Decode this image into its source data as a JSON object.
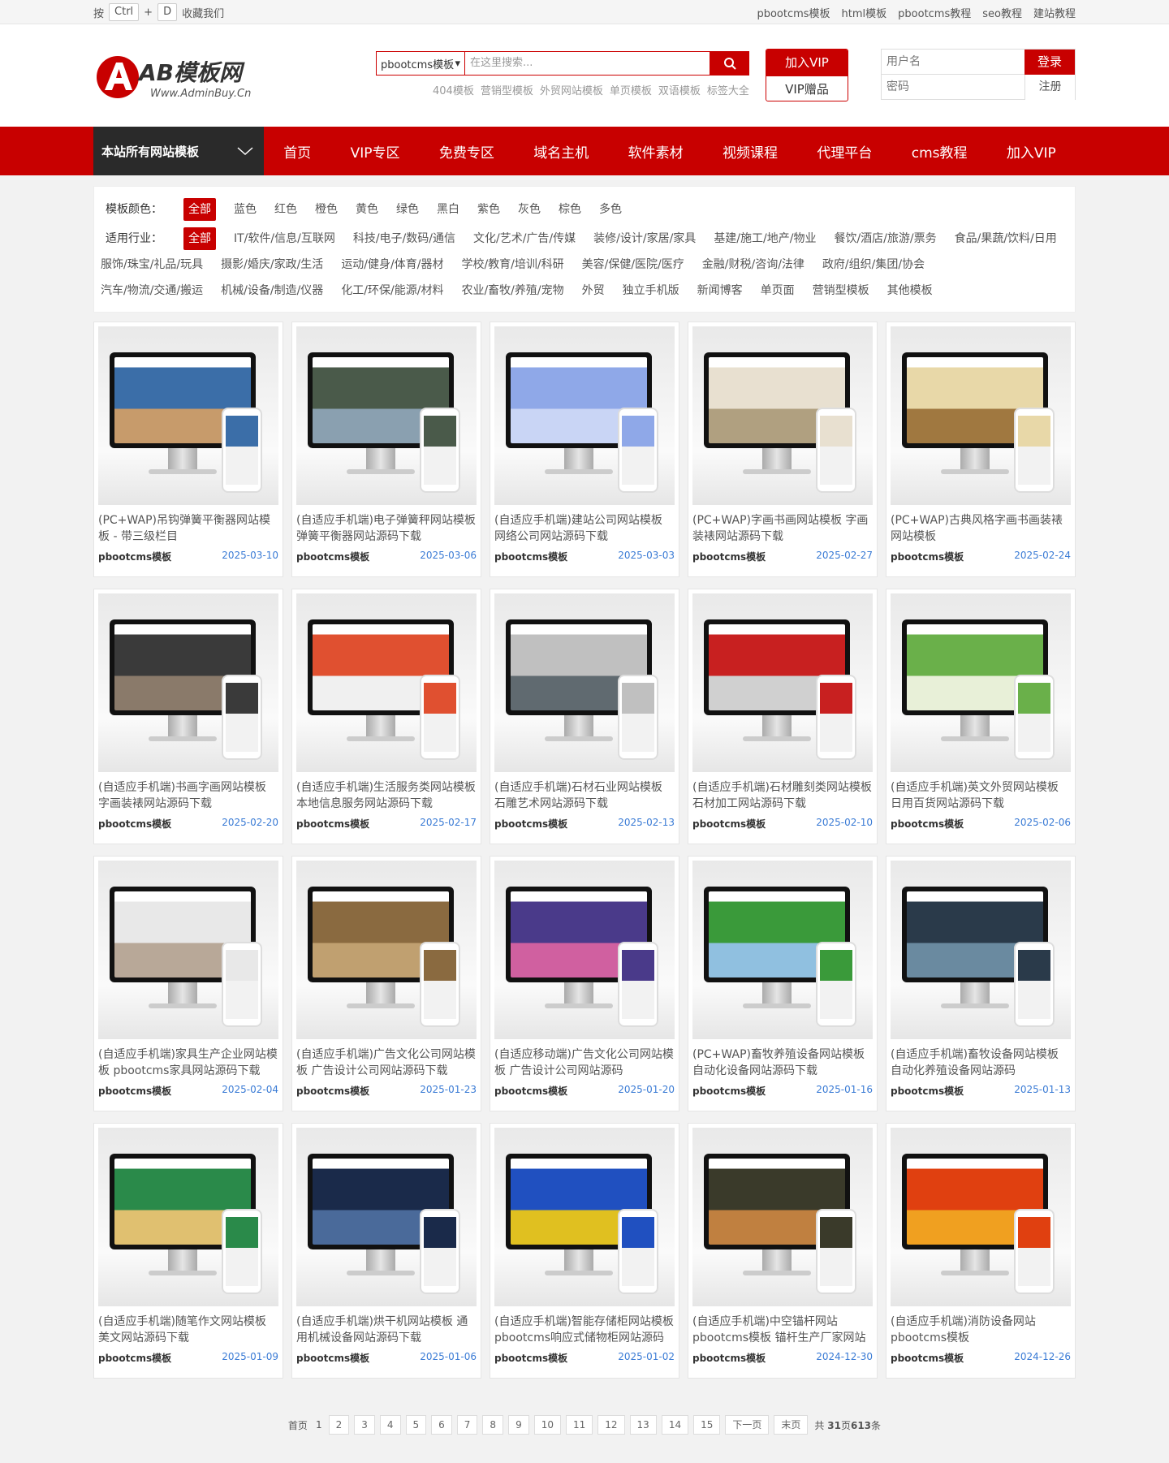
{
  "topbar": {
    "press": "按",
    "key1": "Ctrl",
    "plus": "+",
    "key2": "D",
    "bookmark": "收藏我们",
    "links": [
      "pbootcms模板",
      "html模板",
      "pbootcms教程",
      "seo教程",
      "建站教程"
    ]
  },
  "logo": {
    "text": "AB模板网",
    "sub": "Www.AdminBuy.Cn"
  },
  "search": {
    "select": "pbootcms模板",
    "placeholder": "在这里搜索...",
    "hotwords": [
      "404模板",
      "营销型模板",
      "外贸网站模板",
      "单页模板",
      "双语模板",
      "标签大全"
    ]
  },
  "vip": {
    "join": "加入VIP",
    "gift": "VIP赠品"
  },
  "login": {
    "user": "用户名",
    "pass": "密码",
    "login": "登录",
    "register": "注册"
  },
  "nav": {
    "all": "本站所有网站模板",
    "items": [
      "首页",
      "VIP专区",
      "免费专区",
      "域名主机",
      "软件素材",
      "视频课程",
      "代理平台",
      "cms教程",
      "加入VIP"
    ]
  },
  "filter": {
    "color_label": "模板颜色：",
    "colors": [
      "全部",
      "蓝色",
      "红色",
      "橙色",
      "黄色",
      "绿色",
      "黑白",
      "紫色",
      "灰色",
      "棕色",
      "多色"
    ],
    "industry_label": "适用行业：",
    "industries_row1": [
      "全部",
      "IT/软件/信息/互联网",
      "科技/电子/数码/通信",
      "文化/艺术/广告/传媒",
      "装修/设计/家居/家具",
      "基建/施工/地产/物业",
      "餐饮/酒店/旅游/票务",
      "食品/果蔬/饮料/日用"
    ],
    "industries_row2": [
      "服饰/珠宝/礼品/玩具",
      "摄影/婚庆/家政/生活",
      "运动/健身/体育/器材",
      "学校/教育/培训/科研",
      "美容/保健/医院/医疗",
      "金融/财税/咨询/法律",
      "政府/组织/集团/协会"
    ],
    "industries_row3": [
      "汽车/物流/交通/搬运",
      "机械/设备/制造/仪器",
      "化工/环保/能源/材料",
      "农业/畜牧/养殖/宠物",
      "外贸",
      "独立手机版",
      "新闻博客",
      "单页面",
      "营销型模板",
      "其他模板"
    ]
  },
  "cards": [
    {
      "title": "(PC+WAP)吊钩弹簧平衡器网站模板 - 带三级栏目",
      "cat": "pbootcms模板",
      "date": "2025-03-10",
      "c1": "#3b6ea8",
      "c2": "#c79b6b"
    },
    {
      "title": "(自适应手机端)电子弹簧秤网站模板 弹簧平衡器网站源码下载",
      "cat": "pbootcms模板",
      "date": "2025-03-06",
      "c1": "#4a5a4a",
      "c2": "#8aa0b0"
    },
    {
      "title": "(自适应手机端)建站公司网站模板 网络公司网站源码下载",
      "cat": "pbootcms模板",
      "date": "2025-03-03",
      "c1": "#8fa8e8",
      "c2": "#c9d5f5"
    },
    {
      "title": "(PC+WAP)字画书画网站模板 字画装裱网站源码下载",
      "cat": "pbootcms模板",
      "date": "2025-02-27",
      "c1": "#e8e0d0",
      "c2": "#b0a080"
    },
    {
      "title": "(PC+WAP)古典风格字画书画装裱网站模板",
      "cat": "pbootcms模板",
      "date": "2025-02-24",
      "c1": "#e8d8a8",
      "c2": "#a07840"
    },
    {
      "title": "(自适应手机端)书画字画网站模板 字画装裱网站源码下载",
      "cat": "pbootcms模板",
      "date": "2025-02-20",
      "c1": "#3a3a3a",
      "c2": "#8a7a6a"
    },
    {
      "title": "(自适应手机端)生活服务类网站模板 本地信息服务网站源码下载",
      "cat": "pbootcms模板",
      "date": "2025-02-17",
      "c1": "#e05030",
      "c2": "#f0f0f0"
    },
    {
      "title": "(自适应手机端)石材石业网站模板 石雕艺术网站源码下载",
      "cat": "pbootcms模板",
      "date": "2025-02-13",
      "c1": "#c0c0c0",
      "c2": "#606a70"
    },
    {
      "title": "(自适应手机端)石材雕刻类网站模板 石材加工网站源码下载",
      "cat": "pbootcms模板",
      "date": "2025-02-10",
      "c1": "#c82020",
      "c2": "#d0d0d0"
    },
    {
      "title": "(自适应手机端)英文外贸网站模板 日用百货网站源码下载",
      "cat": "pbootcms模板",
      "date": "2025-02-06",
      "c1": "#6ab04a",
      "c2": "#e8f0d8"
    },
    {
      "title": "(自适应手机端)家具生产企业网站模板 pbootcms家具网站源码下载",
      "cat": "pbootcms模板",
      "date": "2025-02-04",
      "c1": "#e8e8e8",
      "c2": "#b8a898"
    },
    {
      "title": "(自适应手机端)广告文化公司网站模板 广告设计公司网站源码下载",
      "cat": "pbootcms模板",
      "date": "2025-01-23",
      "c1": "#8a6a40",
      "c2": "#c0a070"
    },
    {
      "title": "(自适应移动端)广告文化公司网站模板 广告设计公司网站源码",
      "cat": "pbootcms模板",
      "date": "2025-01-20",
      "c1": "#4a3a8a",
      "c2": "#d060a0"
    },
    {
      "title": "(PC+WAP)畜牧养殖设备网站模板 自动化设备网站源码下载",
      "cat": "pbootcms模板",
      "date": "2025-01-16",
      "c1": "#3a9a3a",
      "c2": "#90c0e0"
    },
    {
      "title": "(自适应手机端)畜牧设备网站模板 自动化养殖设备网站源码",
      "cat": "pbootcms模板",
      "date": "2025-01-13",
      "c1": "#2a3a4a",
      "c2": "#6a8aa0"
    },
    {
      "title": "(自适应手机端)随笔作文网站模板 美文网站源码下载",
      "cat": "pbootcms模板",
      "date": "2025-01-09",
      "c1": "#2a8a4a",
      "c2": "#e0c070"
    },
    {
      "title": "(自适应手机端)烘干机网站模板 通用机械设备网站源码下载",
      "cat": "pbootcms模板",
      "date": "2025-01-06",
      "c1": "#1a2a4a",
      "c2": "#4a6a9a"
    },
    {
      "title": "(自适应手机端)智能存储柜网站模板 pbootcms响应式储物柜网站源码",
      "cat": "pbootcms模板",
      "date": "2025-01-02",
      "c1": "#2050c0",
      "c2": "#e0c020"
    },
    {
      "title": "(自适应手机端)中空锚杆网站 pbootcms模板 锚杆生产厂家网站",
      "cat": "pbootcms模板",
      "date": "2024-12-30",
      "c1": "#3a3a2a",
      "c2": "#c08040"
    },
    {
      "title": "(自适应手机端)消防设备网站 pbootcms模板",
      "cat": "pbootcms模板",
      "date": "2024-12-26",
      "c1": "#e04010",
      "c2": "#f0a020"
    }
  ],
  "pager": {
    "first": "首页",
    "current": "1",
    "pages": [
      "2",
      "3",
      "4",
      "5",
      "6",
      "7",
      "8",
      "9",
      "10",
      "11",
      "12",
      "13",
      "14",
      "15"
    ],
    "next": "下一页",
    "last": "末页",
    "total_pre": "共",
    "total_pages": "31",
    "total_mid": "页",
    "total_count": "613",
    "total_post": "条"
  }
}
